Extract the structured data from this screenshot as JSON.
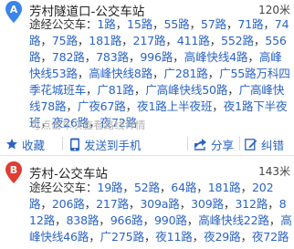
{
  "stations": [
    {
      "marker": "A",
      "marker_color": "#3b84e8",
      "name": "芳村隧道口-公交车站",
      "distance": "120米",
      "routes_prefix": "途经公交车：",
      "routes": [
        "1路",
        "15路",
        "55路",
        "57路",
        "71路",
        "74路",
        "75路",
        "181路",
        "217路",
        "411路",
        "552路",
        "556路",
        "782路",
        "783路",
        "996路",
        "高峰快线4路",
        "高峰快线53路",
        "高峰快线8路",
        "广281路",
        "广55路万科四季花城班车",
        "广81路",
        "广高峰快线50路",
        "广高峰快线78路",
        "广夜67路",
        "夜1路上半夜班",
        "夜1路下半夜班",
        "夜26路",
        "夜72路"
      ],
      "hint": "可点击车次查看路线详情",
      "actions": {
        "favorite": "收藏",
        "send_to_phone": "发送到手机",
        "share": "分享",
        "report_error": "纠错"
      }
    },
    {
      "marker": "B",
      "marker_color": "#e03c31",
      "name": "芳村-公交车站",
      "distance": "143米",
      "routes_prefix": "途经公交车：",
      "routes": [
        "19路",
        "52路",
        "64路",
        "181路",
        "202路",
        "206路",
        "217路",
        "309a路",
        "309路",
        "312路",
        "812路",
        "838路",
        "966路",
        "990路",
        "高峰快线22路",
        "高峰快线46路",
        "广275路",
        "夜11路",
        "夜29路",
        "夜72路"
      ]
    }
  ],
  "colors": {
    "link": "#2b64c4",
    "hint": "#b5b5b5"
  }
}
